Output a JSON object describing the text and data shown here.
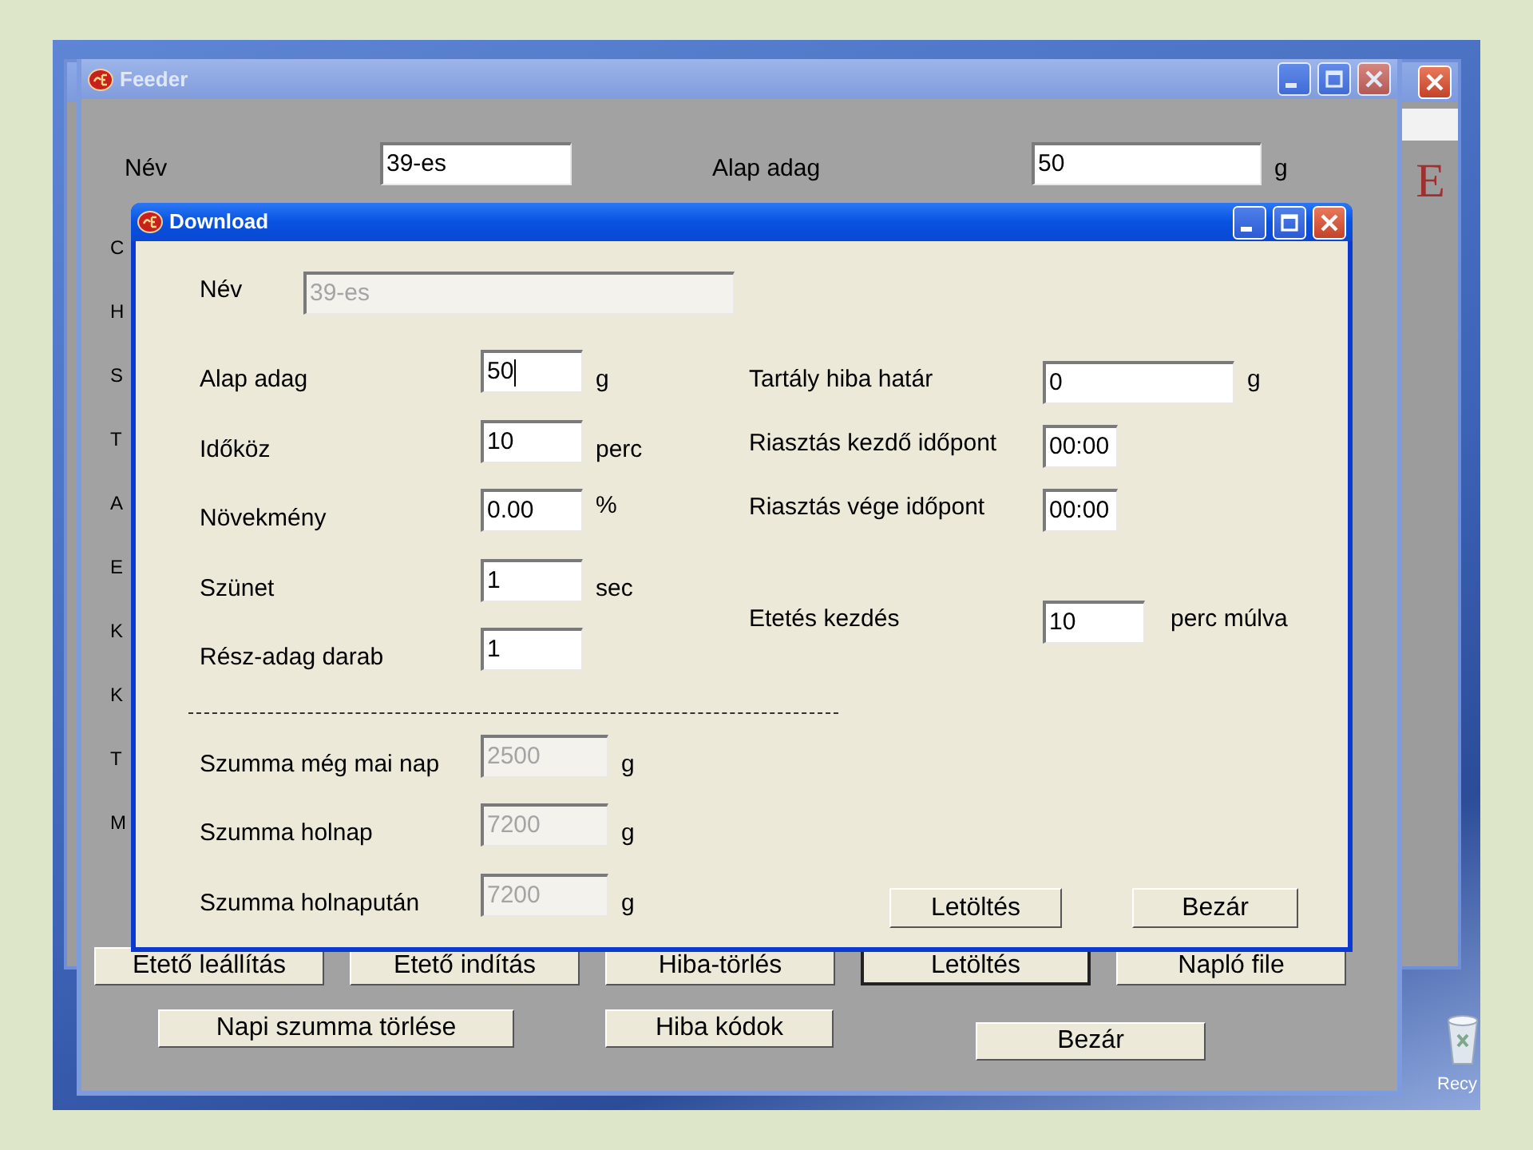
{
  "desktop": {
    "icon_label": "Recy"
  },
  "back_window": {
    "logo_letter": "E"
  },
  "main_window": {
    "title": "Feeder",
    "name_label": "Név",
    "name_value": "39-es",
    "base_label": "Alap adag",
    "base_value": "50",
    "base_unit": "g",
    "cut_labels": [
      "C",
      "H",
      "S",
      "T",
      "A",
      "E",
      "K",
      "K",
      "T",
      "M"
    ],
    "button_row_1": [
      {
        "label": "Etető leállítás",
        "focused": false
      },
      {
        "label": "Etető indítás",
        "focused": false
      },
      {
        "label": "Hiba-törlés",
        "focused": false
      },
      {
        "label": "Letöltés",
        "focused": true
      },
      {
        "label": "Napló file",
        "focused": false
      }
    ],
    "button_row_2": [
      {
        "label": "Napi szumma törlése",
        "focused": false
      },
      {
        "label": "Hiba kódok",
        "focused": false
      }
    ],
    "close_button": "Bezár"
  },
  "dialog": {
    "title": "Download",
    "name_label": "Név",
    "name_value": "39-es",
    "name_disabled": true,
    "left_fields": [
      {
        "label": "Alap adag",
        "value": "50",
        "unit": "g",
        "focused": true
      },
      {
        "label": "Időköz",
        "value": "10",
        "unit": "perc",
        "focused": false
      },
      {
        "label": "Növekmény",
        "value": "0.00",
        "unit": "%",
        "focused": false
      },
      {
        "label": "Szünet",
        "value": "1",
        "unit": "sec",
        "focused": false
      },
      {
        "label": "Rész-adag darab",
        "value": "1",
        "focused": false
      }
    ],
    "right_fields": [
      {
        "label": "Tartály hiba határ",
        "value": "0",
        "unit": "g",
        "kind": "wide"
      },
      {
        "label": "Riasztás kezdő időpont",
        "value": "00:00",
        "kind": "time"
      },
      {
        "label": "Riasztás vége időpont",
        "value": "00:00",
        "kind": "time"
      },
      {
        "kind": "gap"
      },
      {
        "label": "Etetés kezdés",
        "value": "10",
        "unit": "perc múlva",
        "kind": "medium"
      }
    ],
    "sum_fields": [
      {
        "label": "Szumma még mai nap",
        "value": "2500",
        "unit": "g",
        "disabled": true
      },
      {
        "label": "Szumma holnap",
        "value": "7200",
        "unit": "g",
        "disabled": true
      },
      {
        "label": "Szumma holnapután",
        "value": "7200",
        "unit": "g",
        "disabled": true
      }
    ],
    "buttons": [
      "Letöltés",
      "Bezár"
    ]
  }
}
